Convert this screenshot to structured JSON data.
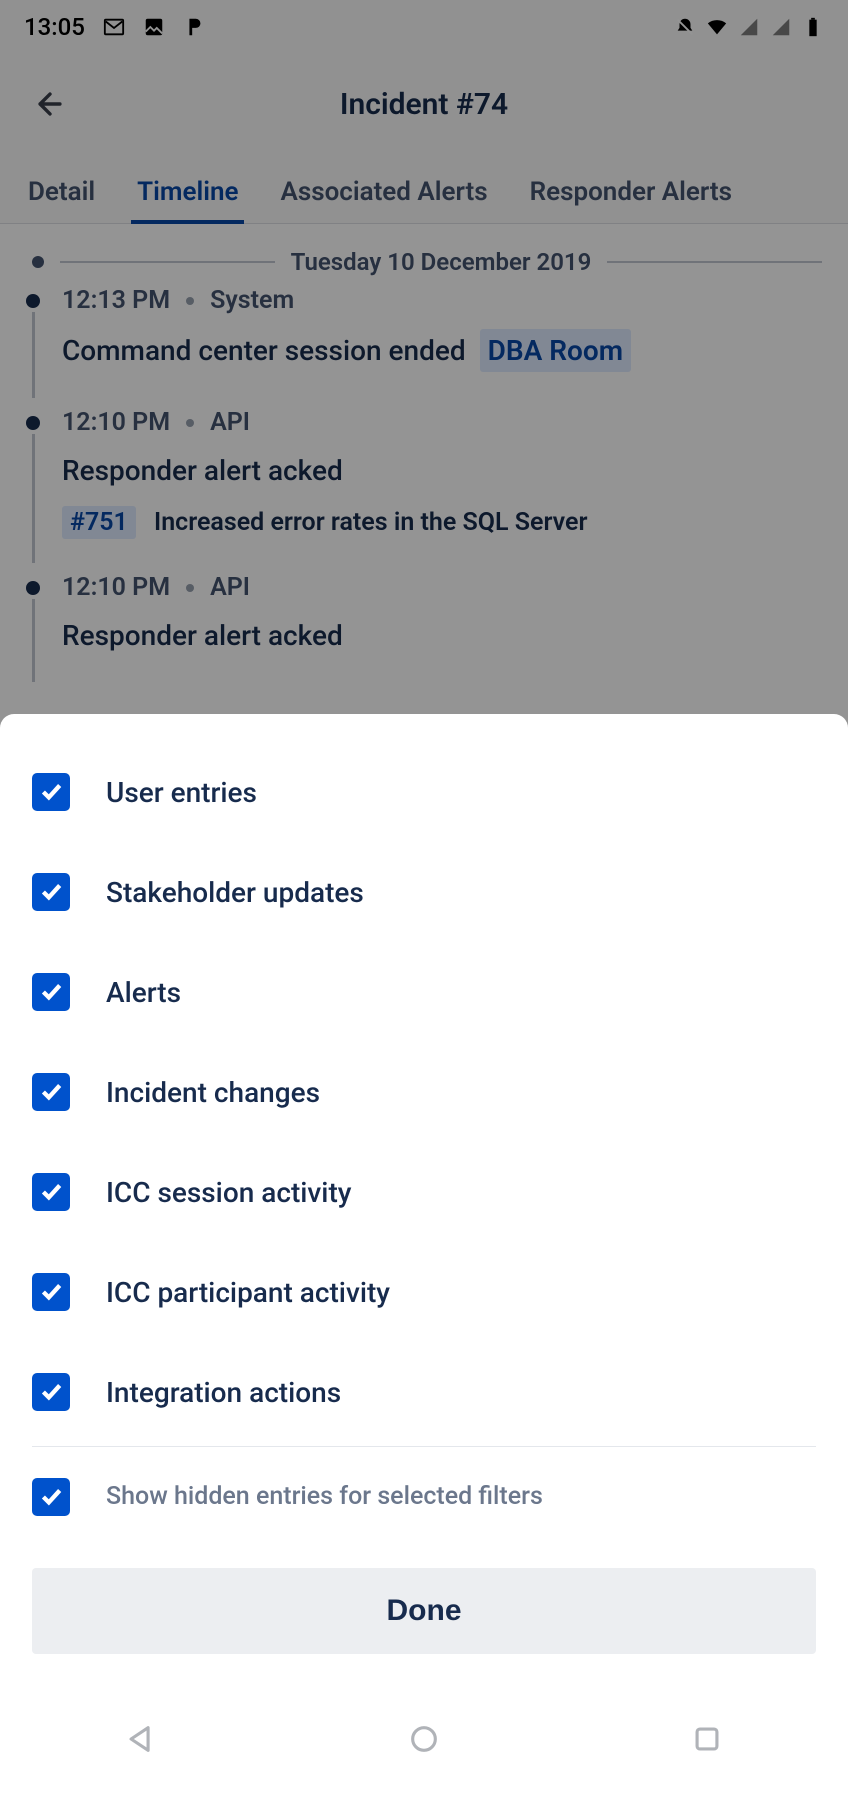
{
  "status": {
    "time": "13:05"
  },
  "header": {
    "title": "Incident #74"
  },
  "tabs": [
    {
      "label": "Detail",
      "active": false
    },
    {
      "label": "Timeline",
      "active": true
    },
    {
      "label": "Associated Alerts",
      "active": false
    },
    {
      "label": "Responder Alerts",
      "active": false
    }
  ],
  "timeline": {
    "date": "Tuesday 10 December 2019",
    "entries": [
      {
        "time": "12:13 PM",
        "source": "System",
        "message": "Command center session ended",
        "pill": "DBA Room"
      },
      {
        "time": "12:10 PM",
        "source": "API",
        "message": "Responder alert acked",
        "ref": "#751",
        "refText": "Increased error rates in the SQL Server"
      },
      {
        "time": "12:10 PM",
        "source": "API",
        "message": "Responder alert acked"
      }
    ]
  },
  "filterSheet": {
    "options": [
      {
        "label": "User entries",
        "checked": true
      },
      {
        "label": "Stakeholder updates",
        "checked": true
      },
      {
        "label": "Alerts",
        "checked": true
      },
      {
        "label": "Incident changes",
        "checked": true
      },
      {
        "label": "ICC session activity",
        "checked": true
      },
      {
        "label": "ICC participant activity",
        "checked": true
      },
      {
        "label": "Integration actions",
        "checked": true
      }
    ],
    "showHidden": {
      "label": "Show hidden entries for selected filters",
      "checked": true
    },
    "doneLabel": "Done"
  }
}
